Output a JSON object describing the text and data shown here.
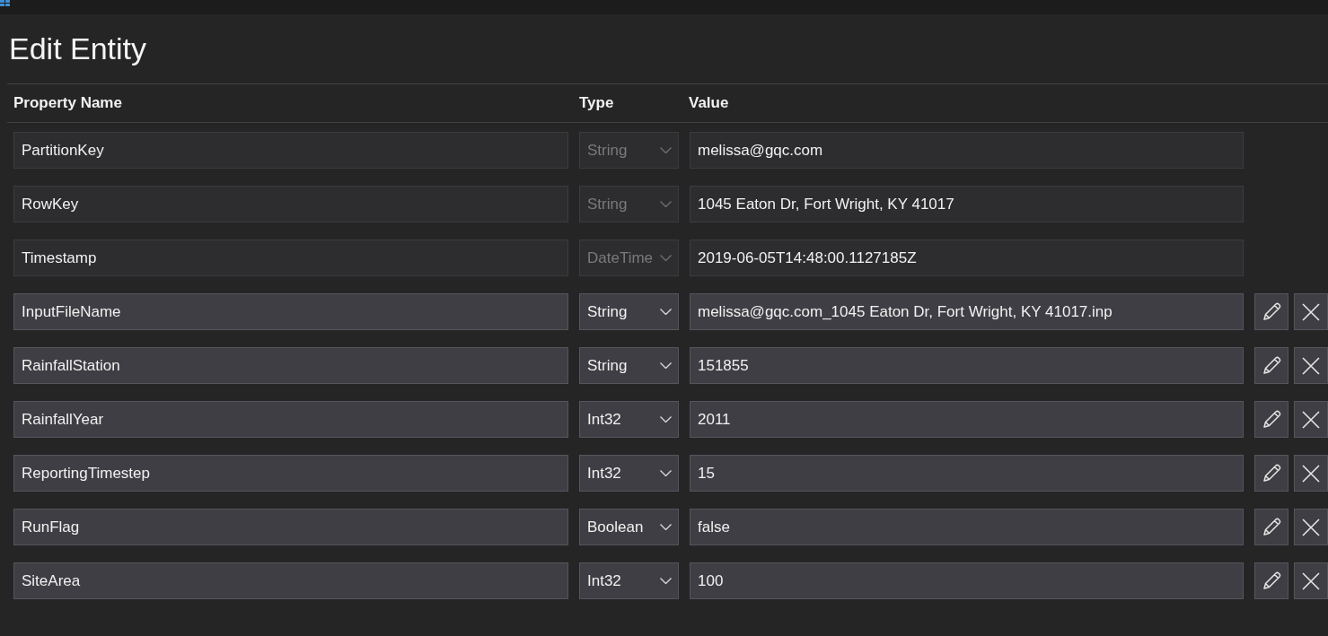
{
  "window": {
    "title": "Edit Entity"
  },
  "columns": [
    "Property Name",
    "Type",
    "Value"
  ],
  "rows": [
    {
      "name": "PartitionKey",
      "type": "String",
      "value": "melissa@gqc.com",
      "editable": false
    },
    {
      "name": "RowKey",
      "type": "String",
      "value": "1045 Eaton Dr, Fort Wright, KY 41017",
      "editable": false
    },
    {
      "name": "Timestamp",
      "type": "DateTime",
      "value": "2019-06-05T14:48:00.1127185Z",
      "editable": false
    },
    {
      "name": "InputFileName",
      "type": "String",
      "value": "melissa@gqc.com_1045 Eaton Dr, Fort Wright, KY 41017.inp",
      "editable": true
    },
    {
      "name": "RainfallStation",
      "type": "String",
      "value": "151855",
      "editable": true
    },
    {
      "name": "RainfallYear",
      "type": "Int32",
      "value": "2011",
      "editable": true
    },
    {
      "name": "ReportingTimestep",
      "type": "Int32",
      "value": "15",
      "editable": true
    },
    {
      "name": "RunFlag",
      "type": "Boolean",
      "value": "false",
      "editable": true
    },
    {
      "name": "SiteArea",
      "type": "Int32",
      "value": "100",
      "editable": true
    }
  ]
}
